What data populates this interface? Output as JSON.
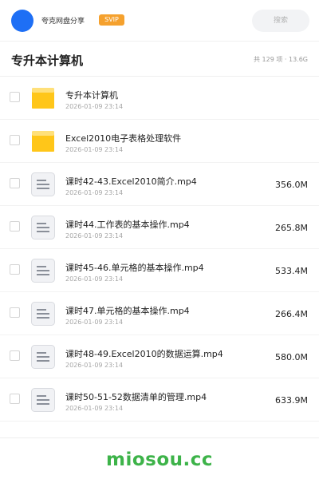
{
  "header": {
    "share_name": "夸克网盘分享",
    "badge": "SVIP",
    "search_placeholder": "搜索"
  },
  "folder": {
    "title": "专升本计算机",
    "stats": "共 129 项 · 13.6G"
  },
  "files": [
    {
      "type": "folder",
      "name": "专升本计算机",
      "date": "2026-01-09 23:14",
      "size": ""
    },
    {
      "type": "folder",
      "name": "Excel2010电子表格处理软件",
      "date": "2026-01-09 23:14",
      "size": ""
    },
    {
      "type": "video",
      "name": "课时42-43.Excel2010简介.mp4",
      "date": "2026-01-09 23:14",
      "size": "356.0M"
    },
    {
      "type": "video",
      "name": "课时44.工作表的基本操作.mp4",
      "date": "2026-01-09 23:14",
      "size": "265.8M"
    },
    {
      "type": "video",
      "name": "课时45-46.单元格的基本操作.mp4",
      "date": "2026-01-09 23:14",
      "size": "533.4M"
    },
    {
      "type": "video",
      "name": "课时47.单元格的基本操作.mp4",
      "date": "2026-01-09 23:14",
      "size": "266.4M"
    },
    {
      "type": "video",
      "name": "课时48-49.Excel2010的数据运算.mp4",
      "date": "2026-01-09 23:14",
      "size": "580.0M"
    },
    {
      "type": "video",
      "name": "课时50-51-52数据清单的管理.mp4",
      "date": "2026-01-09 23:14",
      "size": "633.9M"
    }
  ],
  "footer": {
    "watermark": "miosou.cc"
  },
  "colors": {
    "avatar": "#1e6ff5",
    "svip_badge": "#f5a12e",
    "folder_icon": "#ffc619",
    "watermark": "#3db349"
  },
  "icons": {
    "folder": "folder-icon",
    "video": "file-document-icon"
  }
}
